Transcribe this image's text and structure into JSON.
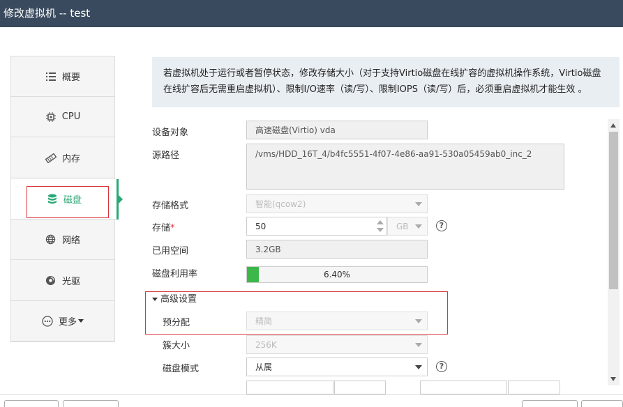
{
  "dialog": {
    "title": "修改虚拟机 -- test"
  },
  "nav": {
    "items": [
      {
        "label": "概要",
        "icon": "list-icon"
      },
      {
        "label": "CPU",
        "icon": "cpu-chip-icon"
      },
      {
        "label": "内存",
        "icon": "memory-icon"
      },
      {
        "label": "磁盘",
        "icon": "database-icon",
        "active": true
      },
      {
        "label": "网络",
        "icon": "globe-icon"
      },
      {
        "label": "光驱",
        "icon": "disc-icon"
      },
      {
        "label": "更多",
        "icon": "more-dots-icon"
      }
    ]
  },
  "notice": {
    "text": "若虚拟机处于运行或者暂停状态，修改存储大小（对于支持Virtio磁盘在线扩容的虚拟机操作系统，Virtio磁盘在线扩容后无需重启虚拟机）、限制I/O速率（读/写）、限制IOPS（读/写）后，必须重启虚拟机才能生效 。"
  },
  "form": {
    "device_label": "设备对象",
    "device_value": "高速磁盘(Virtio) vda",
    "source_label": "源路径",
    "source_value": "/vms/HDD_16T_4/b4fc5551-4f07-4e86-aa91-530a05459ab0_inc_2",
    "format_label": "存储格式",
    "format_value": "智能(qcow2)",
    "storage_label": "存储",
    "storage_required": "*",
    "storage_value": "50",
    "storage_unit": "GB",
    "used_label": "已用空间",
    "used_value": "3.2GB",
    "usage_label": "磁盘利用率",
    "usage_percent_text": "6.40%",
    "usage_fraction": 0.064,
    "advanced_label": "高级设置",
    "prealloc_label": "预分配",
    "prealloc_value": "精简",
    "cluster_label": "簇大小",
    "cluster_value": "256K",
    "mode_label": "磁盘模式",
    "mode_value": "从属"
  },
  "colors": {
    "accent": "#2aa876",
    "titlebar": "#3a4a5e",
    "highlight_box": "#d9363e"
  }
}
